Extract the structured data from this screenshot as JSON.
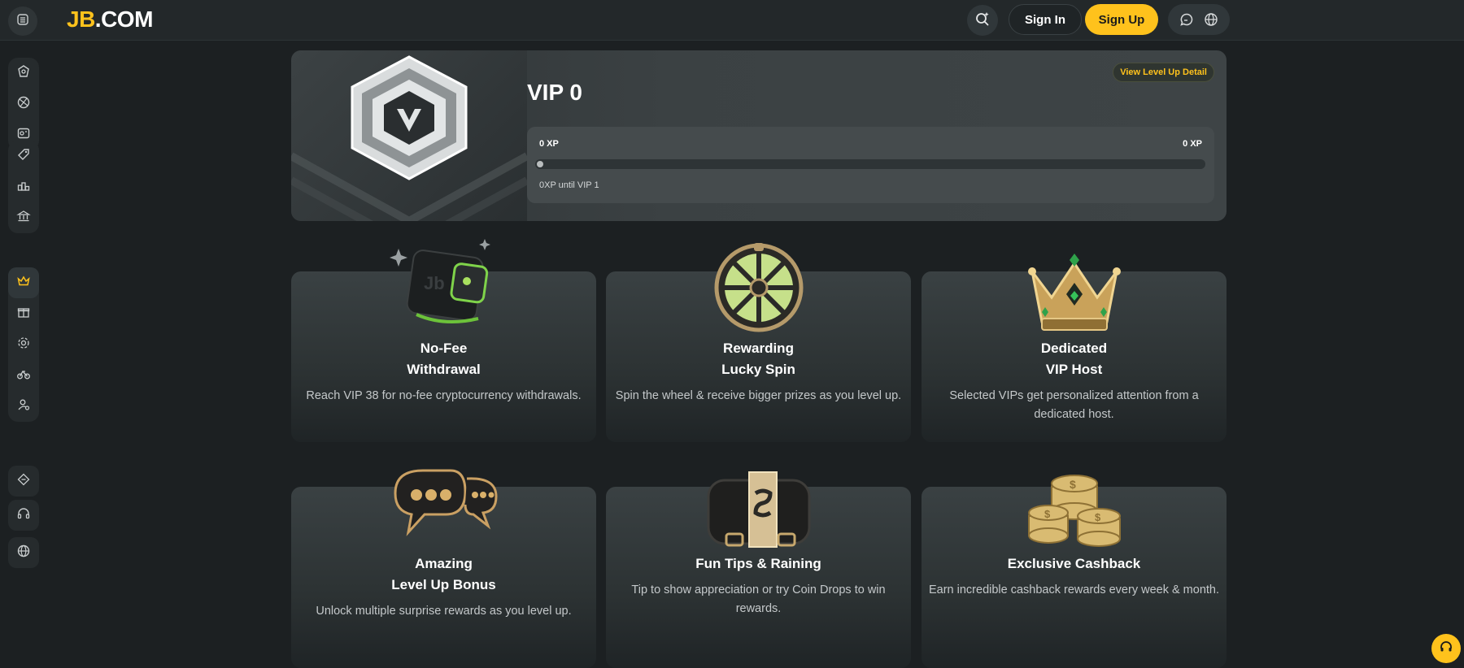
{
  "header": {
    "logo_jb": "JB",
    "logo_com": ".COM",
    "signin_label": "Sign In",
    "signup_label": "Sign Up",
    "icons": [
      "menu-icon",
      "search-icon",
      "chat-icon",
      "globe-icon"
    ]
  },
  "sidebar": {
    "icons": [
      "casino-icon",
      "sports-icon",
      "live-icon",
      "promo-tag-icon",
      "podium-icon",
      "bank-icon",
      "vip-crown-icon",
      "gift-icon",
      "settings-icon",
      "bike-icon",
      "user-referral-icon",
      "coupon-icon",
      "support-headset-icon",
      "globe-icon"
    ],
    "active": "vip-crown-icon",
    "colors": {
      "active": "#ffc21c",
      "default": "#c9cdce"
    }
  },
  "vip": {
    "title": "VIP 0",
    "detail_label": "View Level Up Detail",
    "xp_current_label": "0 XP",
    "xp_target_label": "0 XP",
    "progress": 0.0,
    "until_label": "0XP until VIP 1"
  },
  "features": [
    {
      "title_line1": "No-Fee",
      "title_line2": "Withdrawal",
      "desc": "Reach VIP 38 for no-fee cryptocurrency withdrawals.",
      "icon": "wallet-icon"
    },
    {
      "title_line1": "Rewarding",
      "title_line2": "Lucky Spin",
      "desc": "Spin the wheel & receive bigger prizes as you level up.",
      "icon": "wheel-icon"
    },
    {
      "title_line1": "Dedicated",
      "title_line2": "VIP Host",
      "desc": "Selected VIPs get personalized attention from a dedicated host.",
      "icon": "crown-icon"
    },
    {
      "title_line1": "Amazing",
      "title_line2": "Level Up Bonus",
      "desc": "Unlock multiple surprise rewards as you level up.",
      "icon": "chat-bubbles-icon"
    },
    {
      "title_line1": "Fun Tips & Raining",
      "title_line2": "",
      "desc": "Tip to show appreciation or try Coin Drops to win rewards.",
      "icon": "briefcase-icon"
    },
    {
      "title_line1": "Exclusive Cashback",
      "title_line2": "",
      "desc": "Earn incredible cashback rewards every week & month.",
      "icon": "coins-icon"
    }
  ],
  "colors": {
    "accent": "#ffc21c",
    "background": "#1c2022",
    "card": "#3a4143"
  }
}
